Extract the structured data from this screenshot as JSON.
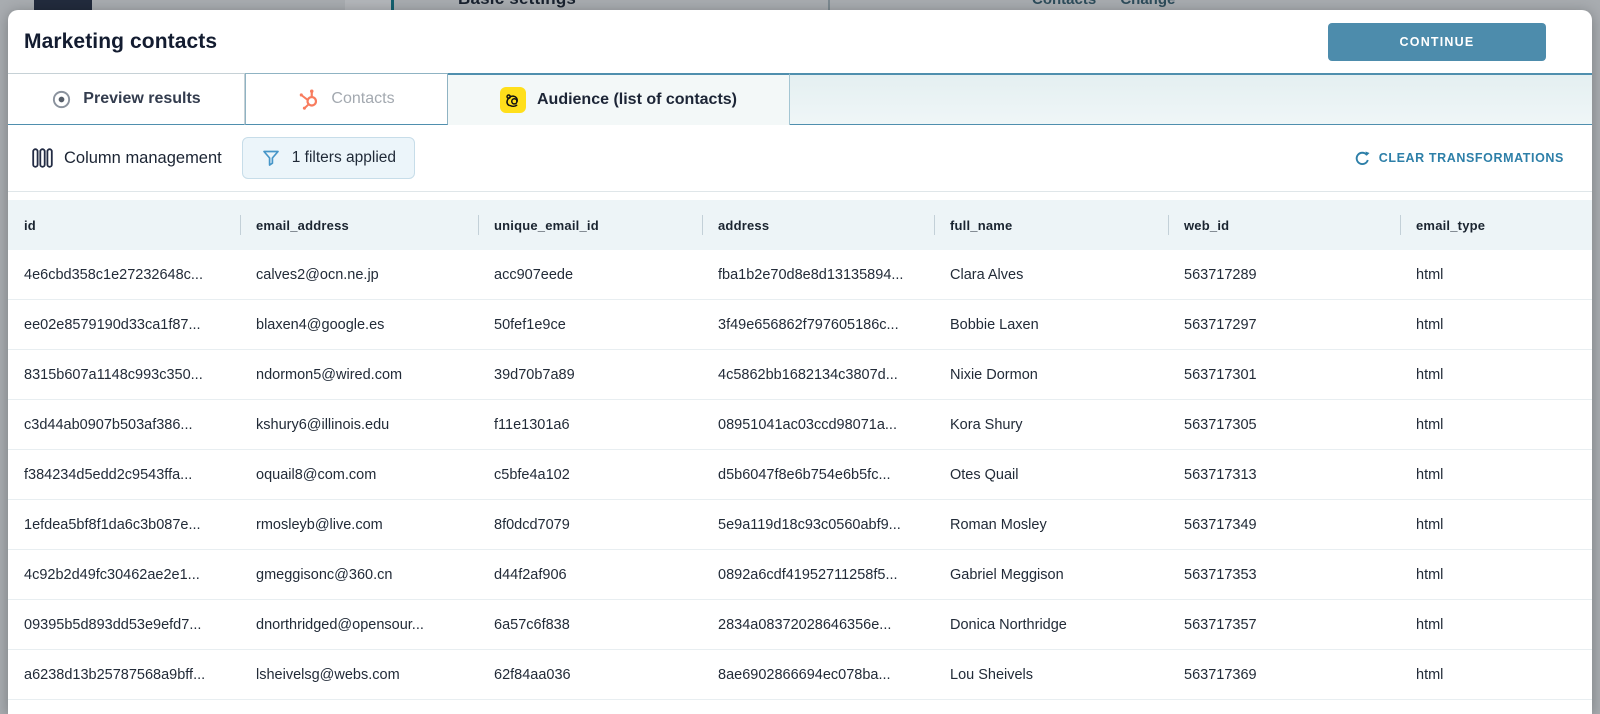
{
  "background_page": {
    "basic_settings_label": "Basic settings",
    "links_label": "Contacts Change"
  },
  "header": {
    "title": "Marketing contacts",
    "continue_label": "CONTINUE"
  },
  "tabs": [
    {
      "label": "Preview results",
      "icon": "preview-eye-icon",
      "state": "inactive"
    },
    {
      "label": "Contacts",
      "icon": "hubspot-icon",
      "state": "muted"
    },
    {
      "label": "Audience (list of contacts)",
      "icon": "mailchimp-icon",
      "state": "active"
    }
  ],
  "toolbar": {
    "column_management_label": "Column management",
    "filters_label": "1 filters applied",
    "clear_transformations_label": "CLEAR TRANSFORMATIONS"
  },
  "table": {
    "columns": [
      "id",
      "email_address",
      "unique_email_id",
      "address",
      "full_name",
      "web_id",
      "email_type"
    ],
    "rows": [
      [
        "4e6cbd358c1e27232648c...",
        "calves2@ocn.ne.jp",
        "acc907eede",
        "fba1b2e70d8e8d13135894...",
        "Clara Alves",
        "563717289",
        "html"
      ],
      [
        "ee02e8579190d33ca1f87...",
        "blaxen4@google.es",
        "50fef1e9ce",
        "3f49e656862f797605186c...",
        "Bobbie Laxen",
        "563717297",
        "html"
      ],
      [
        "8315b607a1148c993c350...",
        "ndormon5@wired.com",
        "39d70b7a89",
        "4c5862bb1682134c3807d...",
        "Nixie Dormon",
        "563717301",
        "html"
      ],
      [
        "c3d44ab0907b503af386...",
        "kshury6@illinois.edu",
        "f11e1301a6",
        "08951041ac03ccd98071a...",
        "Kora Shury",
        "563717305",
        "html"
      ],
      [
        "f384234d5edd2c9543ffa...",
        "oquail8@com.com",
        "c5bfe4a102",
        "d5b6047f8e6b754e6b5fc...",
        "Otes Quail",
        "563717313",
        "html"
      ],
      [
        "1efdea5bf8f1da6c3b087e...",
        "rmosleyb@live.com",
        "8f0dcd7079",
        "5e9a119d18c93c0560abf9...",
        "Roman Mosley",
        "563717349",
        "html"
      ],
      [
        "4c92b2d49fc30462ae2e1...",
        "gmeggisonc@360.cn",
        "d44f2af906",
        "0892a6cdf41952711258f5...",
        "Gabriel Meggison",
        "563717353",
        "html"
      ],
      [
        "09395b5d893dd53e9efd7...",
        "dnorthridged@opensour...",
        "6a57c6f838",
        "2834a08372028646356e...",
        "Donica Northridge",
        "563717357",
        "html"
      ],
      [
        "a6238d13b25787568a9bff...",
        "lsheivelsg@webs.com",
        "62f84aa036",
        "8ae6902866694ec078ba...",
        "Lou Sheivels",
        "563717369",
        "html"
      ]
    ]
  },
  "colors": {
    "continue_button": "#4d8cac",
    "accent_blue": "#2d7fa8",
    "tab_border_blue": "#4f8fae",
    "table_header_bg": "#edf4f7",
    "hubspot_orange": "#f87c5e",
    "mailchimp_yellow": "#ffdf1b",
    "filters_button_bg": "#ecf5fa"
  }
}
